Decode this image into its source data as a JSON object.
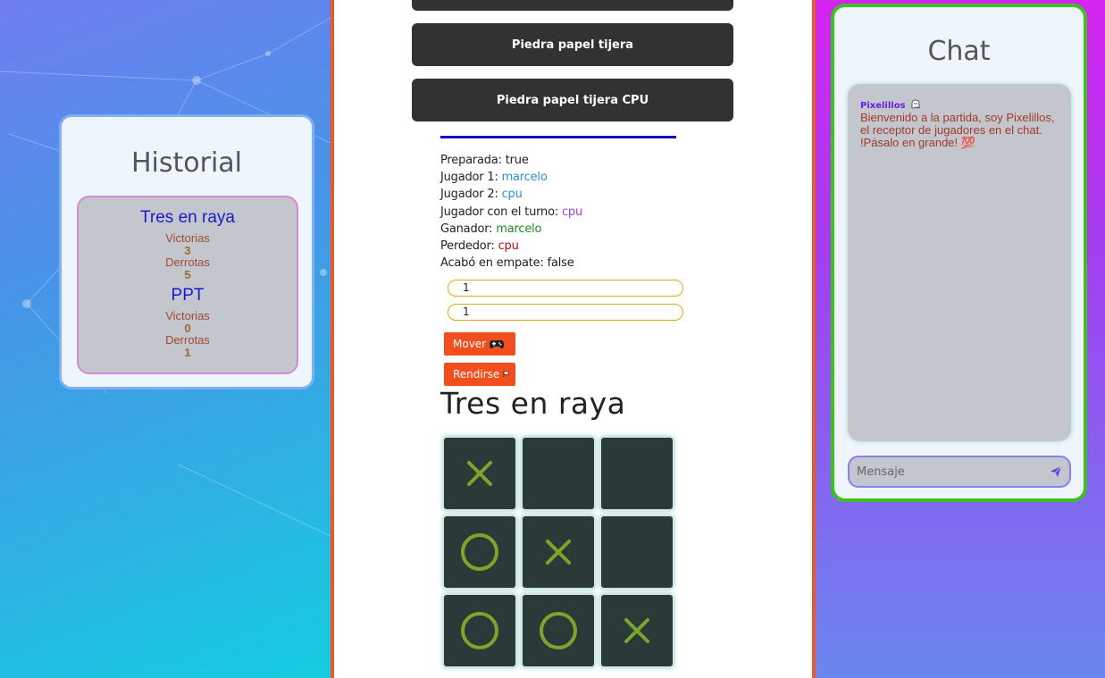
{
  "historial": {
    "title": "Historial",
    "games": [
      {
        "name": "Tres en raya",
        "wins_label": "Victorias",
        "wins": "3",
        "losses_label": "Derrotas",
        "losses": "5"
      },
      {
        "name": "PPT",
        "wins_label": "Victorias",
        "wins": "0",
        "losses_label": "Derrotas",
        "losses": "1"
      }
    ]
  },
  "menu": {
    "buttons": [
      "Piedra papel tijera",
      "Piedra papel tijera CPU"
    ]
  },
  "game_info": {
    "prepared_label": "Preparada:",
    "prepared": "true",
    "player1_label": "Jugador 1:",
    "player1": "marcelo",
    "player2_label": "Jugador 2:",
    "player2": "cpu",
    "turn_label": "Jugador con el turno:",
    "turn": "cpu",
    "winner_label": "Ganador:",
    "winner": "marcelo",
    "loser_label": "Perdedor:",
    "loser": "cpu",
    "draw_label": "Acabó en empate:",
    "draw": "false"
  },
  "move_inputs": [
    "1",
    "1"
  ],
  "actions": {
    "move_label": "Mover",
    "move_icon": "gamepad-icon",
    "surrender_label": "Rendirse",
    "surrender_icon": "flag-icon"
  },
  "board": {
    "title": "Tres en raya",
    "cells": [
      "X",
      "",
      "",
      "O",
      "X",
      "",
      "O",
      "O",
      "X"
    ]
  },
  "chat": {
    "title": "Chat",
    "messages": [
      {
        "user": "Pixelillos",
        "user_icon": "ghost-icon",
        "text": "Bienvenido a la partida, soy Pixelillos, el receptor de jugadores en el chat. !Pásalo en grande! 💯"
      }
    ],
    "input_placeholder": "Mensaje",
    "send_icon": "send-icon"
  },
  "colors": {
    "orange_accent": "#ea5a28",
    "chat_border": "#3fbf24",
    "board_mark": "#7aa62c"
  }
}
